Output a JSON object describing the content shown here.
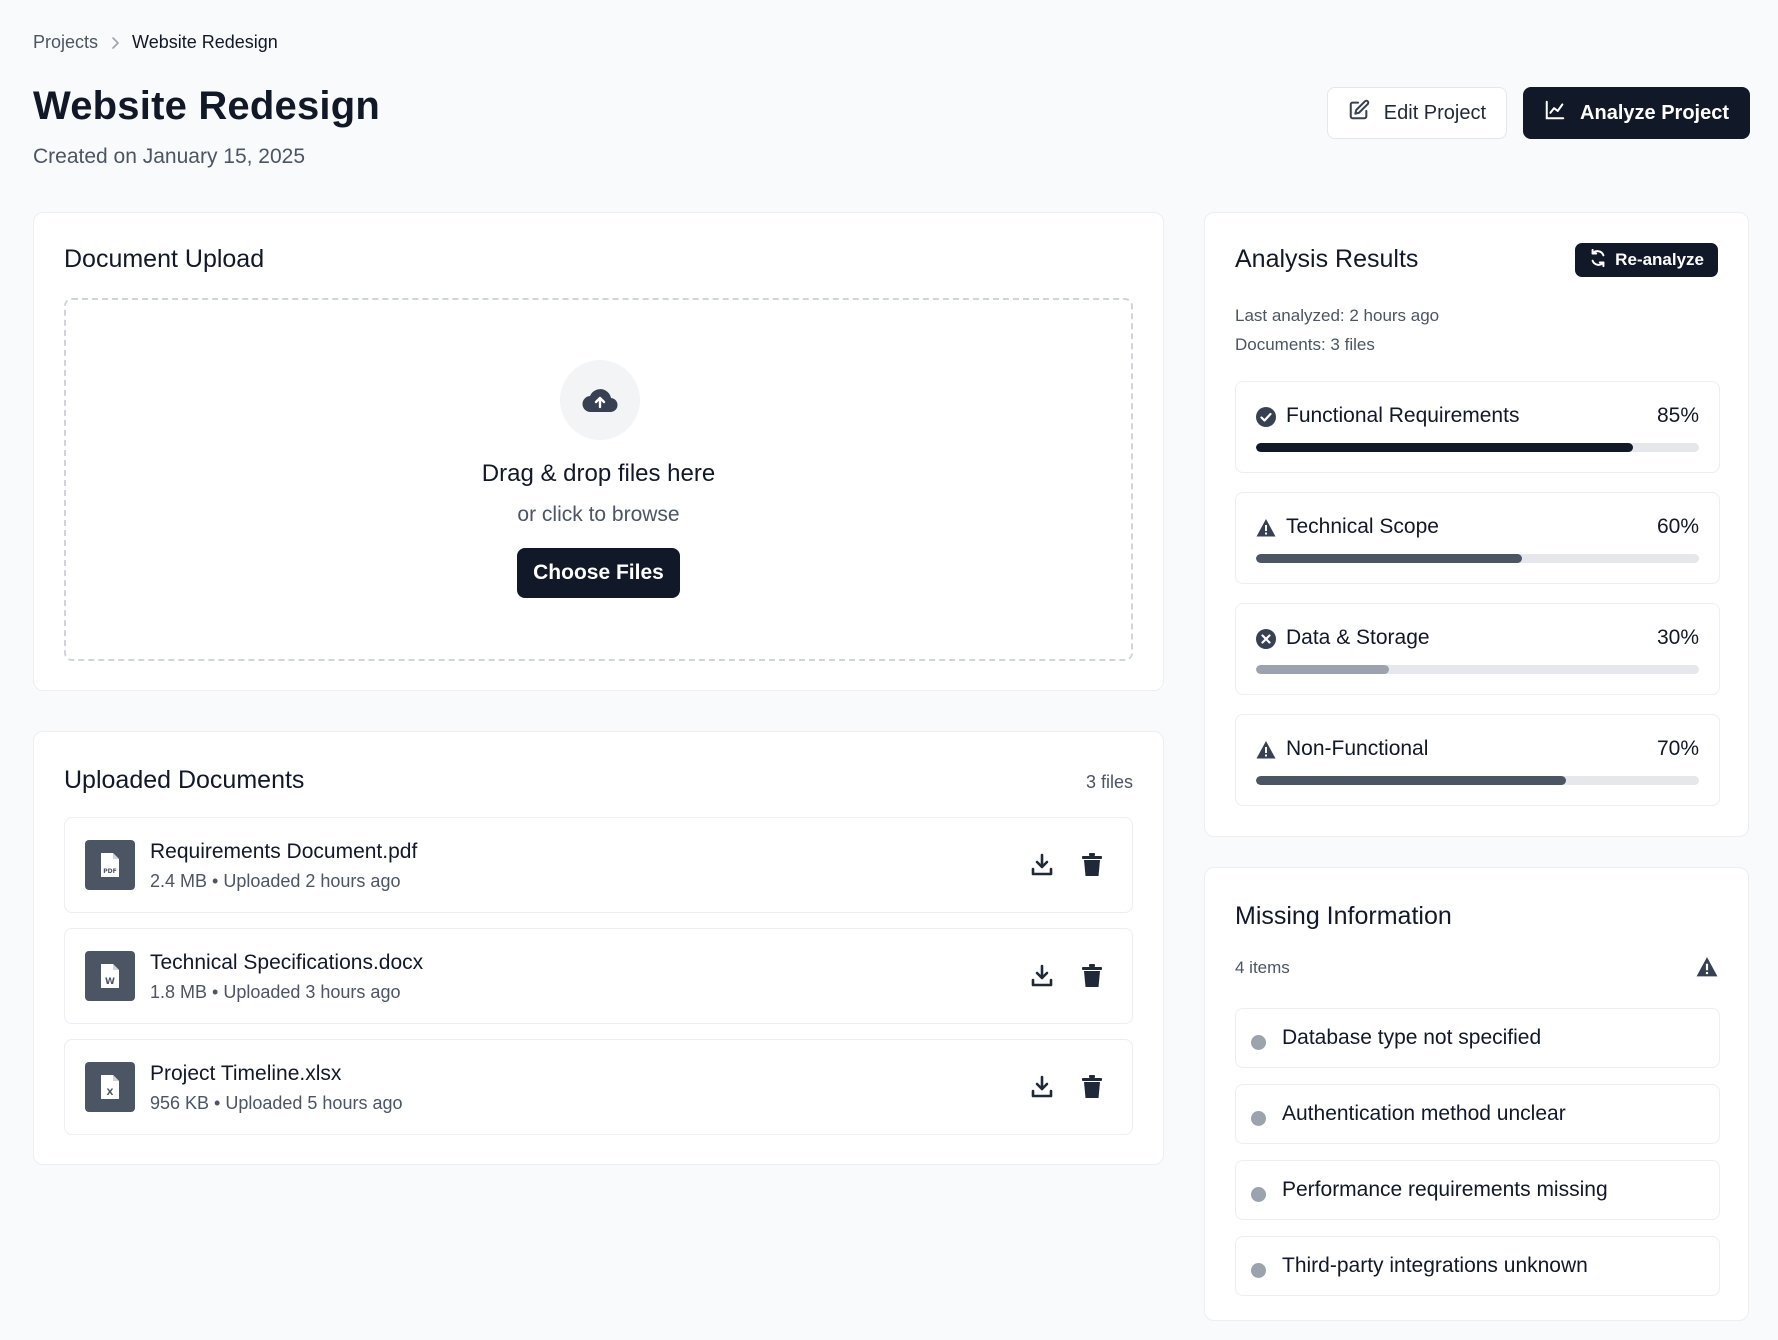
{
  "breadcrumb": {
    "parent": "Projects",
    "current": "Website Redesign"
  },
  "header": {
    "title": "Website Redesign",
    "subtitle": "Created on January 15, 2025",
    "edit_label": "Edit Project",
    "analyze_label": "Analyze Project"
  },
  "upload": {
    "title": "Document Upload",
    "drop_title": "Drag & drop files here",
    "drop_sub": "or click to browse",
    "button_label": "Choose Files"
  },
  "documents": {
    "title": "Uploaded Documents",
    "count": "3 files",
    "items": [
      {
        "name": "Requirements Document.pdf",
        "meta": "2.4 MB • Uploaded 2 hours ago",
        "icon": "pdf-file-icon"
      },
      {
        "name": "Technical Specifications.docx",
        "meta": "1.8 MB • Uploaded 3 hours ago",
        "icon": "word-file-icon"
      },
      {
        "name": "Project Timeline.xlsx",
        "meta": "956 KB • Uploaded 5 hours ago",
        "icon": "excel-file-icon"
      }
    ]
  },
  "analysis": {
    "title": "Analysis Results",
    "reanalyze_label": "Re-analyze",
    "last_analyzed": "Last analyzed: 2 hours ago",
    "documents": "Documents: 3 files",
    "metrics": [
      {
        "label": "Functional Requirements",
        "pct_text": "85%",
        "value": 0.85,
        "status": "complete",
        "icon": "check-circle-icon",
        "color": "#111827"
      },
      {
        "label": "Technical Scope",
        "pct_text": "60%",
        "value": 0.6,
        "status": "warning",
        "icon": "warning-icon",
        "color": "#4b5563"
      },
      {
        "label": "Data & Storage",
        "pct_text": "30%",
        "value": 0.3,
        "status": "error",
        "icon": "x-circle-icon",
        "color": "#9ca3af"
      },
      {
        "label": "Non-Functional",
        "pct_text": "70%",
        "value": 0.7,
        "status": "warning",
        "icon": "warning-icon",
        "color": "#4b5563"
      }
    ]
  },
  "missing": {
    "title": "Missing Information",
    "count": "4 items",
    "items": [
      "Database type not specified",
      "Authentication method unclear",
      "Performance requirements missing",
      "Third-party integrations unknown"
    ]
  },
  "colors": {
    "primary": "#111827",
    "muted": "#4b5563",
    "track": "#e5e7eb",
    "background": "#f9fafb"
  }
}
